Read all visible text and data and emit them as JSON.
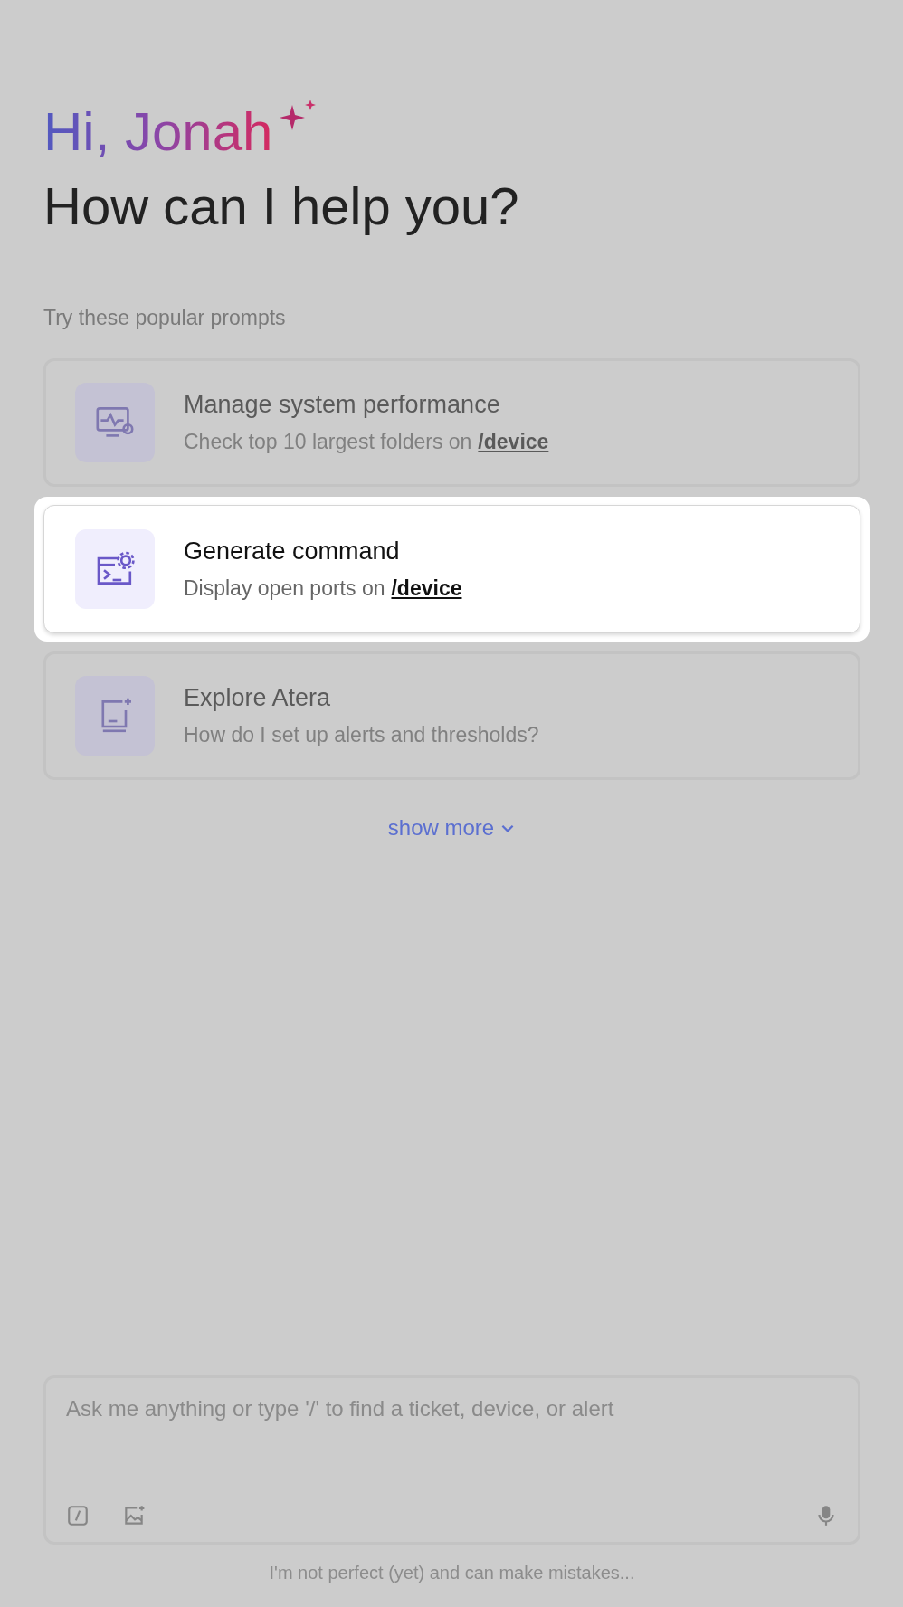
{
  "greeting": "Hi, Jonah",
  "heading": "How can I help you?",
  "prompts_label": "Try these popular prompts",
  "prompts": [
    {
      "kind": "performance",
      "title": "Manage system performance",
      "subtitle": "Check top 10 largest folders on",
      "link": "/device",
      "selected": false
    },
    {
      "kind": "command",
      "title": "Generate command",
      "subtitle": "Display open ports on",
      "link": "/device",
      "selected": true
    },
    {
      "kind": "book",
      "title": "Explore Atera",
      "subtitle": "How do I set up alerts and thresholds?",
      "selected": false
    }
  ],
  "show_more": "show more",
  "composer": {
    "placeholder": "Ask me anything or type '/' to find a ticket, device, or alert"
  },
  "disclaimer": "I'm not perfect (yet) and can make mistakes..."
}
